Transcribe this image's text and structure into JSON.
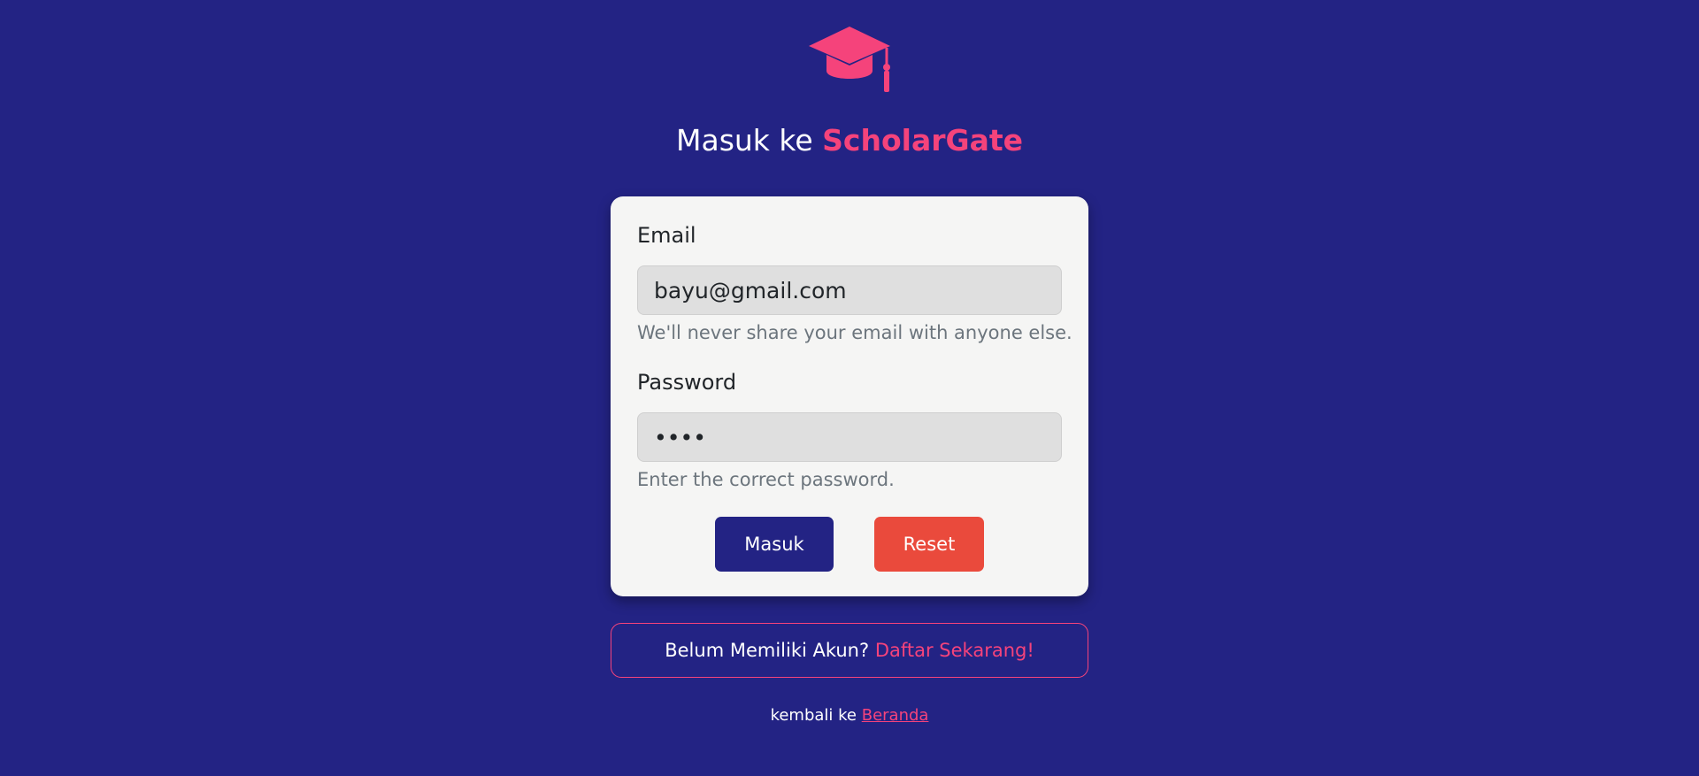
{
  "colors": {
    "background": "#232384",
    "accent": "#f5437b",
    "card": "#f5f5f4",
    "primary_button": "#232384",
    "reset_button": "#ea4a3c"
  },
  "logo": {
    "icon": "graduation-cap-icon"
  },
  "header": {
    "prefix": "Masuk ke ",
    "brand": "ScholarGate"
  },
  "form": {
    "email": {
      "label": "Email",
      "value": "bayu@gmail.com",
      "help": "We'll never share your email with anyone else."
    },
    "password": {
      "label": "Password",
      "value": "abcd",
      "help": "Enter the correct password."
    },
    "submit_label": "Masuk",
    "reset_label": "Reset"
  },
  "register": {
    "text": "Belum Memiliki Akun? ",
    "link": "Daftar Sekarang!"
  },
  "back": {
    "text": "kembali ke ",
    "link": "Beranda"
  }
}
